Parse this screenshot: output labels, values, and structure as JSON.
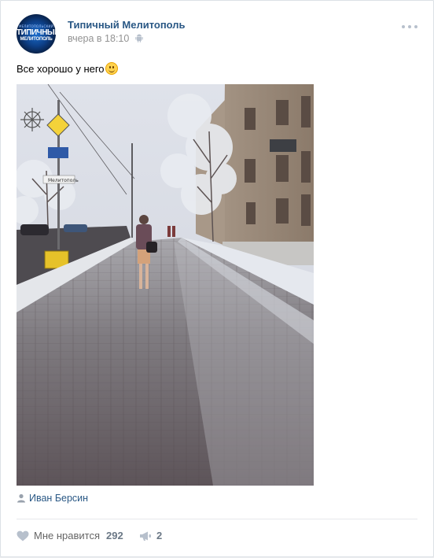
{
  "post": {
    "author": "Типичный Мелитополь",
    "time": "вчера в 18:10",
    "text": "Все хорошо у него",
    "signer": "Иван Берсин"
  },
  "avatar": {
    "top_text": "МЕЛИТОПОЛЬСКИЙ",
    "line1": "ТИПИЧНЫЙ",
    "line2": "МЕЛИТОПОЛЬ"
  },
  "photo_sign_text": "Мелитополь",
  "actions": {
    "like_label": "Мне нравится",
    "like_count": "292",
    "share_count": "2"
  },
  "icons": {
    "more": "more-dots-icon",
    "platform": "android-icon",
    "emoji": "smiling-face-emoji",
    "user": "user-icon",
    "like": "heart-icon",
    "share": "megaphone-share-icon"
  },
  "colors": {
    "author_link": "#2a5885",
    "meta": "#939393",
    "icon": "#b7c0cc",
    "page_bg": "#edeef0"
  }
}
